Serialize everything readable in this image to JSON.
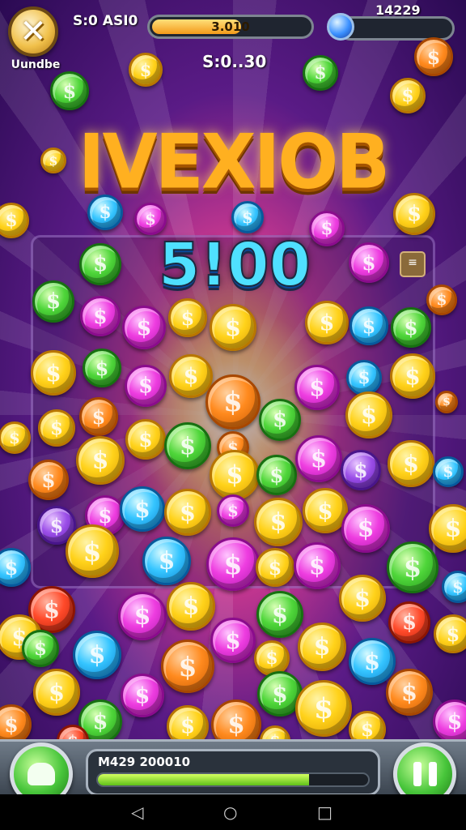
{
  "header": {
    "close_icon": "close-x-icon",
    "undo_label": "Uundbe",
    "score_label": "S:0 ASI0",
    "bar_text": "3.010",
    "bar_progress": 0.55,
    "timer": "S:0..30",
    "gem_icon": "blue-gem-icon",
    "gem_count": "14229"
  },
  "title": "IVEXIOB",
  "multiplier": "5!00",
  "board_icon": "menu-icon",
  "coin_symbol": "$",
  "colors": {
    "gold": "#ffd21a",
    "orange": "#ff8a1e",
    "pink": "#ee3de0",
    "green": "#4fd63a",
    "blue": "#35c5ff",
    "red": "#ff4a2a",
    "purple": "#9b4ee8"
  },
  "footer": {
    "left_button_icon": "bell-icon",
    "progress_label": "M429 200010",
    "progress": 0.78,
    "right_button_icon": "pause-icon"
  },
  "navbar": {
    "back_icon": "◁",
    "home_icon": "○",
    "recents_icon": "□"
  }
}
